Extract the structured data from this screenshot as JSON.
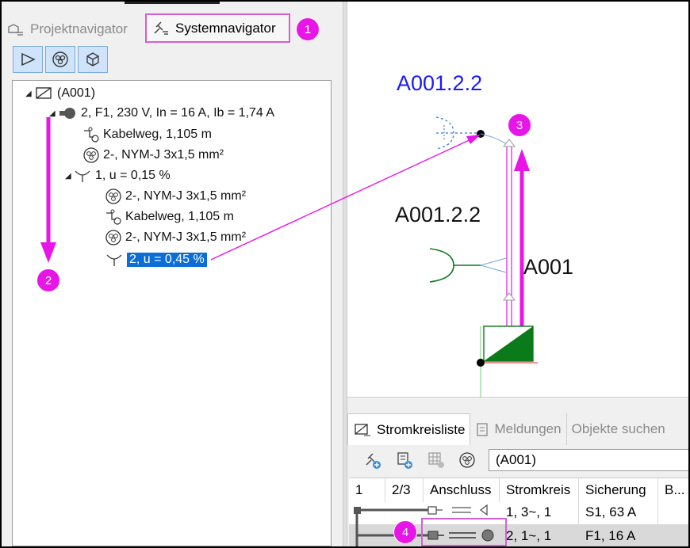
{
  "tabs": {
    "project": "Projektnavigator",
    "system": "Systemnavigator"
  },
  "badges": [
    "1",
    "2",
    "3",
    "4"
  ],
  "tree": {
    "root": "(A001)",
    "circuit": "2, F1, 230 V, In = 16 A, Ib = 1,74 A",
    "cable_route_1": "Kabelweg, 1,105 m",
    "cable_1": "2-, NYM-J 3x1,5 mm²",
    "consumer_1": "1, u = 0,15 %",
    "cable_2": "2-, NYM-J 3x1,5 mm²",
    "cable_route_2": "Kabelweg, 1,105 m",
    "cable_3": "2-, NYM-J 3x1,5 mm²",
    "consumer_2_selected": "2, u = 0,45 %"
  },
  "canvas": {
    "label_top": "A001.2.2",
    "label_mid": "A001.2.2",
    "label_right": "A001"
  },
  "bottom": {
    "tabs": [
      "Stromkreisliste",
      "Meldungen",
      "Objekte suchen"
    ],
    "selector_value": "(A001)",
    "columns": [
      "1",
      "2/3",
      "Anschluss",
      "Stromkreis",
      "Sicherung",
      "B..."
    ],
    "rows": [
      {
        "stromkreis": "1, 3~, 1",
        "sicherung": "S1, 63 A"
      },
      {
        "stromkreis": "2, 1~, 1",
        "sicherung": "F1, 16 A"
      }
    ]
  },
  "colors": {
    "badge": "#e815e8",
    "annotation_arrow": "#e815e8",
    "selection": "#0a6dd8",
    "canvas_label_blue": "#1a1aff"
  }
}
